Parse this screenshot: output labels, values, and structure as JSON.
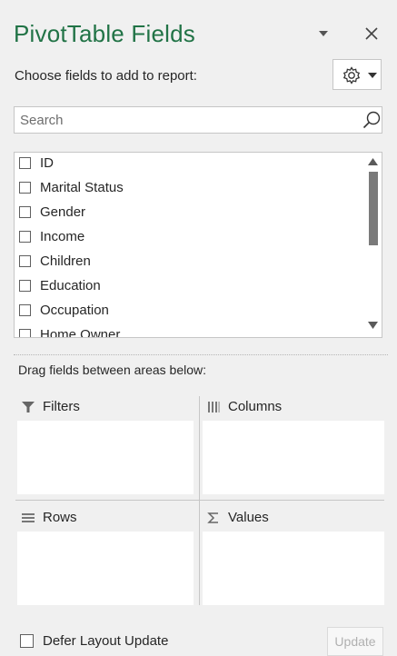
{
  "panel": {
    "title": "PivotTable Fields",
    "choose_label": "Choose fields to add to report:",
    "accent_color": "#217346"
  },
  "search": {
    "placeholder": "Search",
    "value": ""
  },
  "fields": [
    {
      "label": "ID",
      "checked": false
    },
    {
      "label": "Marital Status",
      "checked": false
    },
    {
      "label": "Gender",
      "checked": false
    },
    {
      "label": "Income",
      "checked": false
    },
    {
      "label": "Children",
      "checked": false
    },
    {
      "label": "Education",
      "checked": false
    },
    {
      "label": "Occupation",
      "checked": false
    },
    {
      "label": "Home Owner",
      "checked": false
    }
  ],
  "areas": {
    "drag_label": "Drag fields between areas below:",
    "filters": "Filters",
    "columns": "Columns",
    "rows": "Rows",
    "values": "Values"
  },
  "footer": {
    "defer_label": "Defer Layout Update",
    "defer_checked": false,
    "update_label": "Update"
  },
  "icons": {
    "collapse": "chevron-down-icon",
    "close": "close-icon",
    "tools": "gear-icon",
    "search": "search-icon",
    "filters": "filter-icon",
    "columns": "columns-icon",
    "rows": "rows-icon",
    "values": "sigma-icon"
  }
}
